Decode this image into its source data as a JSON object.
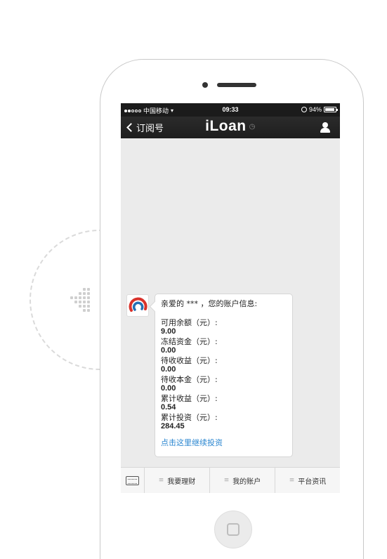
{
  "status_bar": {
    "carrier": "中国移动",
    "time": "09:33",
    "battery": "94%",
    "battery_level": 0.94
  },
  "nav": {
    "back_label": "订阅号",
    "title": "iLoan"
  },
  "message": {
    "greeting": "亲爱的 *** ，您的账户信息:",
    "rows": [
      {
        "label": "可用余额（元）:",
        "value": "9.00"
      },
      {
        "label": "冻结资金（元）:",
        "value": "0.00"
      },
      {
        "label": "待收收益（元）:",
        "value": "0.00"
      },
      {
        "label": "待收本金（元）:",
        "value": "0.00"
      },
      {
        "label": "累计收益（元）:",
        "value": "0.54"
      },
      {
        "label": "累计投资（元）:",
        "value": "284.45"
      }
    ],
    "link": "点击这里继续投资"
  },
  "menu": {
    "items": [
      "我要理财",
      "我的账户",
      "平台资讯"
    ]
  },
  "colors": {
    "link": "#2a86d0",
    "nav_bg": "#1e1e1e",
    "chat_bg": "#ebebeb",
    "logo_red": "#d9322b",
    "logo_blue": "#2470b5"
  }
}
